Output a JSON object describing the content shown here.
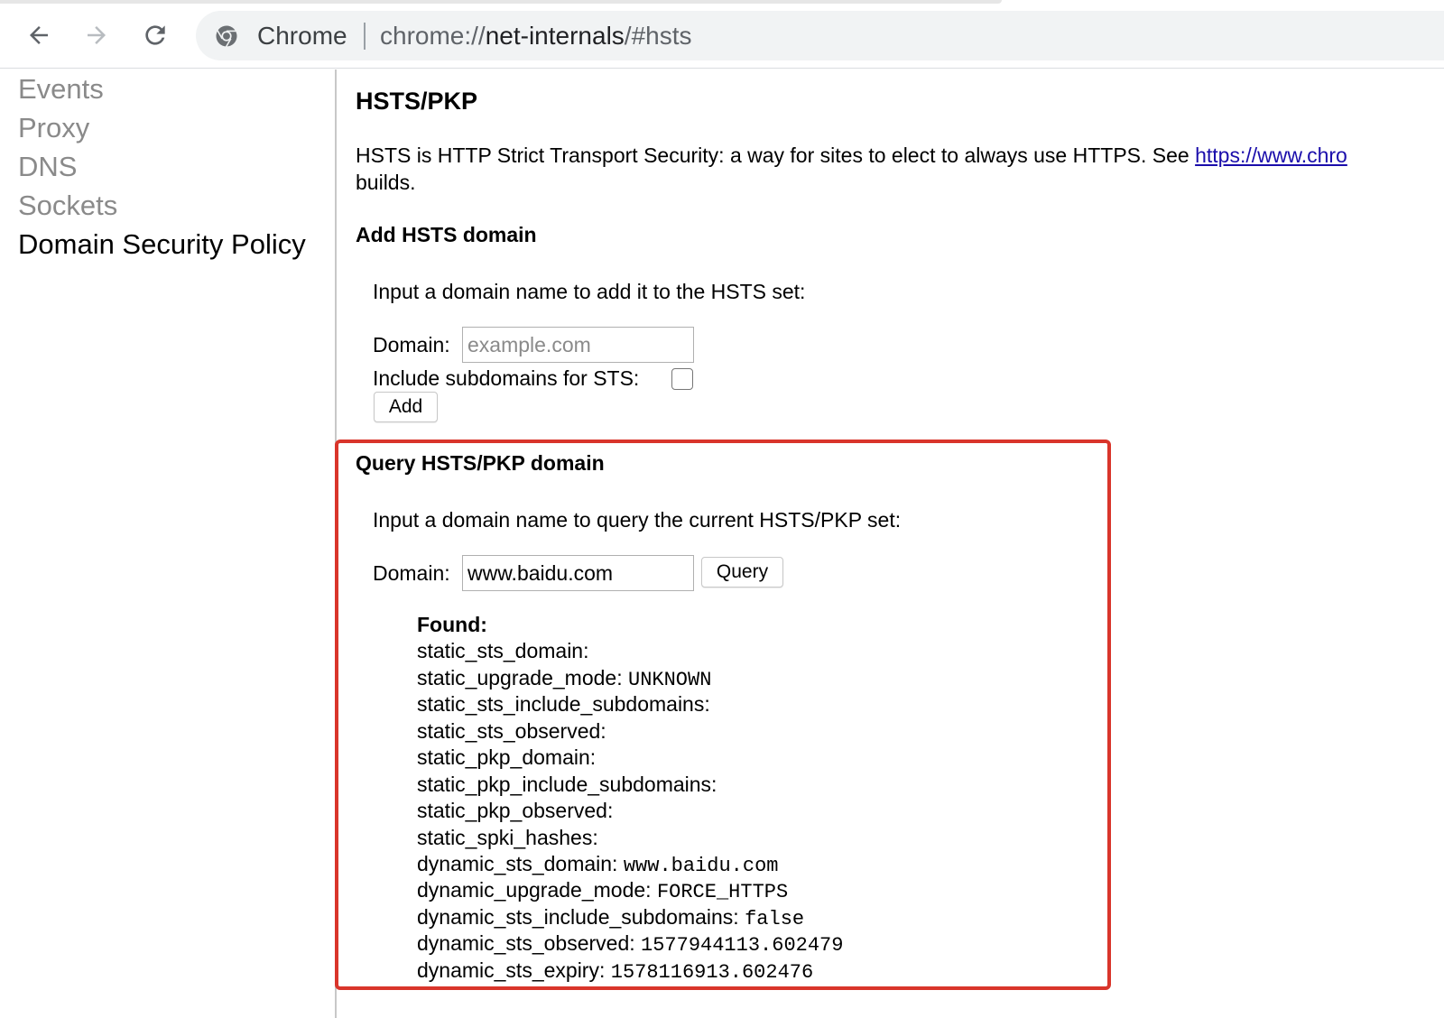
{
  "browser": {
    "site_name": "Chrome",
    "url_scheme": "chrome://",
    "url_host": "net-internals",
    "url_path": "/#hsts",
    "icons": [
      "back-icon",
      "forward-icon",
      "reload-icon",
      "chrome-icon"
    ]
  },
  "sidebar": {
    "items": [
      {
        "label": "Events",
        "selected": false
      },
      {
        "label": "Proxy",
        "selected": false
      },
      {
        "label": "DNS",
        "selected": false
      },
      {
        "label": "Sockets",
        "selected": false
      },
      {
        "label": "Domain Security Policy",
        "selected": true
      }
    ]
  },
  "main": {
    "title": "HSTS/PKP",
    "description_prefix": "HSTS is HTTP Strict Transport Security: a way for sites to elect to always use HTTPS. See ",
    "description_link": "https://www.chro",
    "description_suffix": "builds.",
    "add_section": {
      "title": "Add HSTS domain",
      "instruction": "Input a domain name to add it to the HSTS set:",
      "domain_label": "Domain:",
      "domain_placeholder": "example.com",
      "domain_value": "",
      "subdomains_label": "Include subdomains for STS:",
      "subdomains_checked": false,
      "add_button": "Add"
    },
    "query_section": {
      "title": "Query HSTS/PKP domain",
      "instruction": "Input a domain name to query the current HSTS/PKP set:",
      "domain_label": "Domain:",
      "domain_value": "www.baidu.com",
      "query_button": "Query",
      "found_label": "Found:",
      "results": [
        {
          "key": "static_sts_domain:",
          "value": ""
        },
        {
          "key": "static_upgrade_mode:",
          "value": "UNKNOWN"
        },
        {
          "key": "static_sts_include_subdomains:",
          "value": ""
        },
        {
          "key": "static_sts_observed:",
          "value": ""
        },
        {
          "key": "static_pkp_domain:",
          "value": ""
        },
        {
          "key": "static_pkp_include_subdomains:",
          "value": ""
        },
        {
          "key": "static_pkp_observed:",
          "value": ""
        },
        {
          "key": "static_spki_hashes:",
          "value": ""
        },
        {
          "key": "dynamic_sts_domain:",
          "value": "www.baidu.com"
        },
        {
          "key": "dynamic_upgrade_mode:",
          "value": "FORCE_HTTPS"
        },
        {
          "key": "dynamic_sts_include_subdomains:",
          "value": "false"
        },
        {
          "key": "dynamic_sts_observed:",
          "value": "1577944113.602479"
        },
        {
          "key": "dynamic_sts_expiry:",
          "value": "1578116913.602476"
        }
      ]
    }
  },
  "colors": {
    "link": "#1a0dab",
    "highlight_border": "#d9352b",
    "sidebar_inactive": "#8a8a8a",
    "sidebar_active": "#000000",
    "omnibox_bg": "#f1f3f4"
  }
}
